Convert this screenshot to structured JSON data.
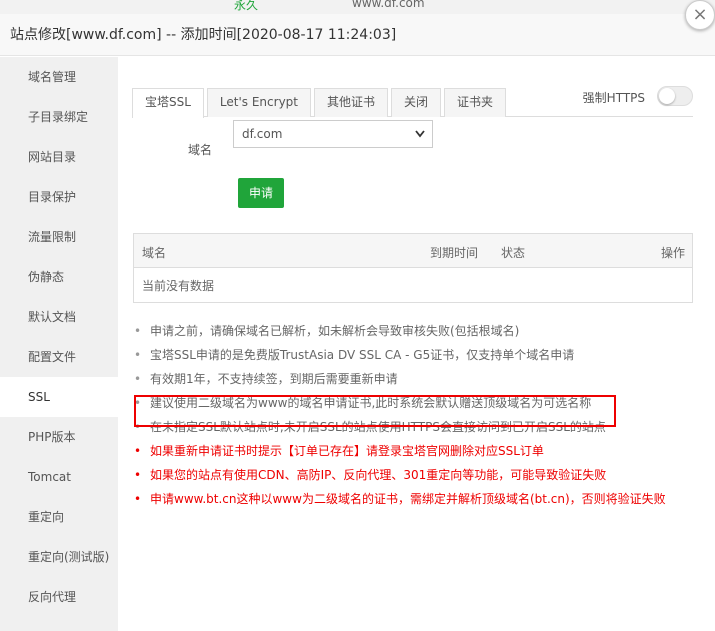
{
  "background": {
    "status": "永久",
    "domain": "www.df.com"
  },
  "dialog": {
    "title": "站点修改[www.df.com] -- 添加时间[2020-08-17 11:24:03]",
    "close_glyph": "×"
  },
  "sidebar": {
    "items": [
      {
        "label": "域名管理"
      },
      {
        "label": "子目录绑定"
      },
      {
        "label": "网站目录"
      },
      {
        "label": "目录保护"
      },
      {
        "label": "流量限制"
      },
      {
        "label": "伪静态"
      },
      {
        "label": "默认文档"
      },
      {
        "label": "配置文件"
      },
      {
        "label": "SSL"
      },
      {
        "label": "PHP版本"
      },
      {
        "label": "Tomcat"
      },
      {
        "label": "重定向"
      },
      {
        "label": "重定向(测试版)"
      },
      {
        "label": "反向代理"
      }
    ]
  },
  "ssl": {
    "tabs": [
      {
        "label": "宝塔SSL"
      },
      {
        "label": "Let's Encrypt"
      },
      {
        "label": "其他证书"
      },
      {
        "label": "关闭"
      },
      {
        "label": "证书夹"
      }
    ],
    "force_https_label": "强制HTTPS",
    "domain_label": "域名",
    "domain_value": "df.com",
    "apply_label": "申请",
    "table": {
      "columns": [
        "域名",
        "到期时间",
        "状态",
        "操作"
      ],
      "empty_text": "当前没有数据"
    },
    "notes": [
      {
        "text": "申请之前，请确保域名已解析，如未解析会导致审核失败(包括根域名)"
      },
      {
        "text": "宝塔SSL申请的是免费版TrustAsia DV SSL CA - G5证书，仅支持单个域名申请"
      },
      {
        "text": "有效期1年，不支持续签，到期后需要重新申请"
      },
      {
        "text": "建议使用二级域名为www的域名申请证书,此时系统会默认赠送顶级域名为可选名称"
      },
      {
        "text": "在未指定SSL默认站点时,未开启SSL的站点使用HTTPS会直接访问到已开启SSL的站点"
      },
      {
        "text": "如果重新申请证书时提示【订单已存在】请登录宝塔官网删除对应SSL订单"
      },
      {
        "text": "如果您的站点有使用CDN、高防IP、反向代理、301重定向等功能，可能导致验证失败"
      },
      {
        "text": "申请www.bt.cn这种以www为二级域名的证书，需绑定并解析顶级域名(bt.cn)，否则将验证失败"
      }
    ],
    "bullet": "•"
  },
  "colors": {
    "accent_green": "#20a53a",
    "warning_red": "#ee0000"
  }
}
